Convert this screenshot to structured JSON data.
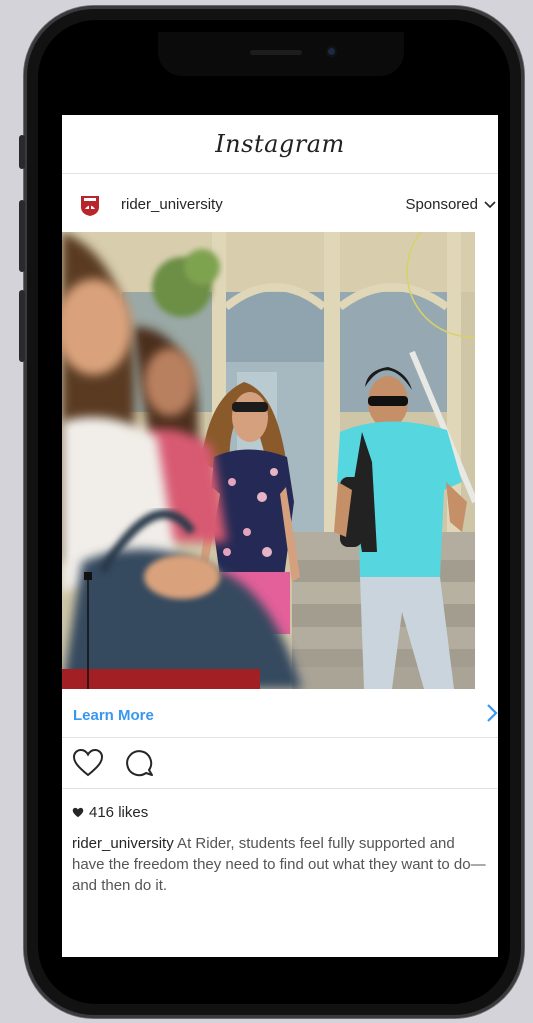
{
  "app": {
    "logo_text": "Instagram"
  },
  "post": {
    "username": "rider_university",
    "sponsored_label": "Sponsored",
    "cta_label": "Learn More",
    "likes_text": "416 likes",
    "caption_user": "rider_university",
    "caption_text": " At Rider, students feel fully supported and have the freedom they need to find out what they want to do—and then do it."
  },
  "colors": {
    "cta_blue": "#3897f0",
    "brand_red": "#a21f24"
  },
  "icons": [
    "rider-logo-icon",
    "chevron-down-icon",
    "chevron-right-icon",
    "heart-icon",
    "comment-icon",
    "heart-filled-icon"
  ]
}
